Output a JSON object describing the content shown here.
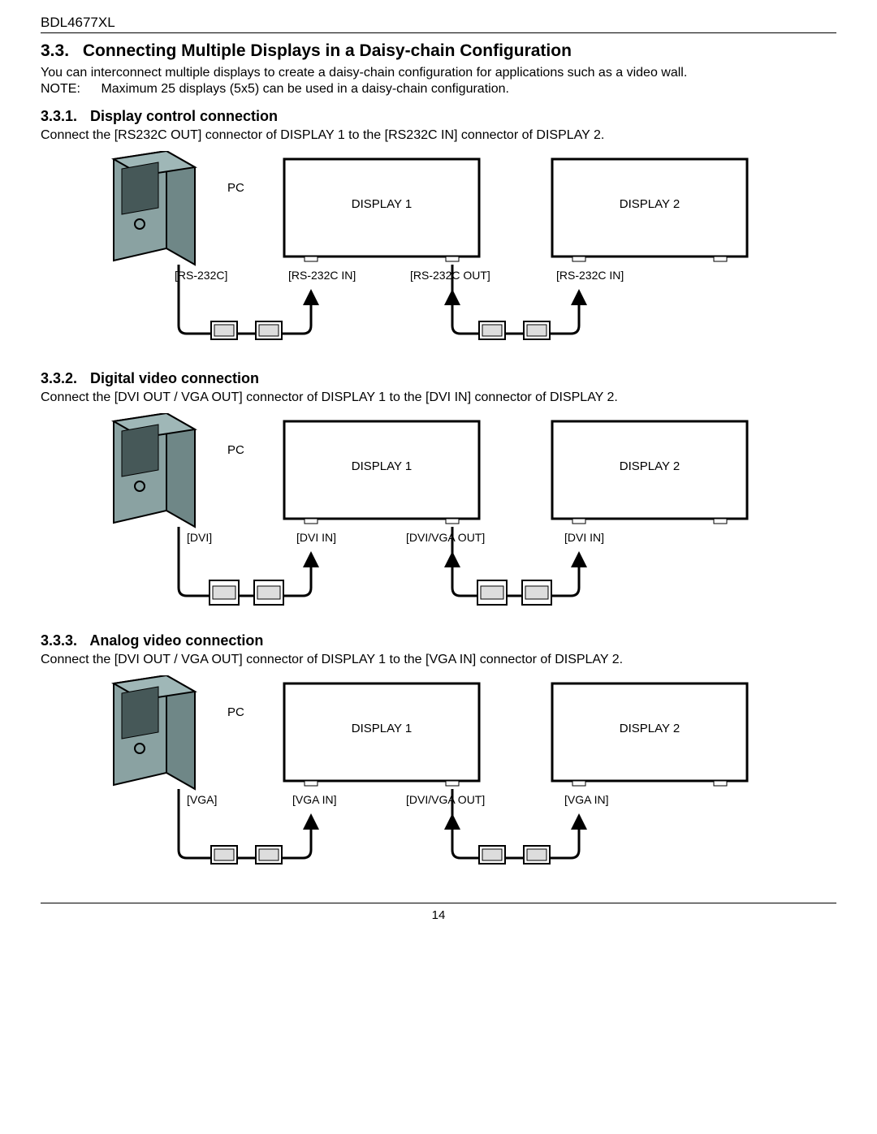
{
  "header": {
    "model": "BDL4677XL"
  },
  "section": {
    "num": "3.3.",
    "title": "Connecting Multiple Displays in a Daisy-chain Configuration",
    "intro": "You can interconnect multiple displays to create a daisy-chain configuration for applications such as a video wall.",
    "note_label": "NOTE:",
    "note_text": "Maximum 25 displays (5x5) can be used in a daisy-chain configuration."
  },
  "sub1": {
    "num": "3.3.1.",
    "title": "Display control connection",
    "desc": "Connect the [RS232C OUT] connector of DISPLAY 1 to the [RS232C IN] connector of DISPLAY 2.",
    "labels": {
      "pc": "PC",
      "d1": "DISPLAY 1",
      "d2": "DISPLAY 2",
      "pc_port": "[RS-232C]",
      "d1_in": "[RS-232C IN]",
      "d1_out": "[RS-232C OUT]",
      "d2_in": "[RS-232C IN]"
    }
  },
  "sub2": {
    "num": "3.3.2.",
    "title": "Digital video connection",
    "desc": "Connect the [DVI OUT / VGA OUT] connector of DISPLAY 1 to the [DVI IN] connector of DISPLAY 2.",
    "labels": {
      "pc": "PC",
      "d1": "DISPLAY 1",
      "d2": "DISPLAY 2",
      "pc_port": "[DVI]",
      "d1_in": "[DVI IN]",
      "d1_out": "[DVI/VGA OUT]",
      "d2_in": "[DVI IN]"
    }
  },
  "sub3": {
    "num": "3.3.3.",
    "title": "Analog video connection",
    "desc": "Connect the [DVI OUT / VGA OUT] connector of DISPLAY 1 to the [VGA IN] connector of DISPLAY 2.",
    "labels": {
      "pc": "PC",
      "d1": "DISPLAY 1",
      "d2": "DISPLAY 2",
      "pc_port": "[VGA]",
      "d1_in": "[VGA IN]",
      "d1_out": "[DVI/VGA OUT]",
      "d2_in": "[VGA IN]"
    }
  },
  "footer": {
    "page_number": "14"
  }
}
